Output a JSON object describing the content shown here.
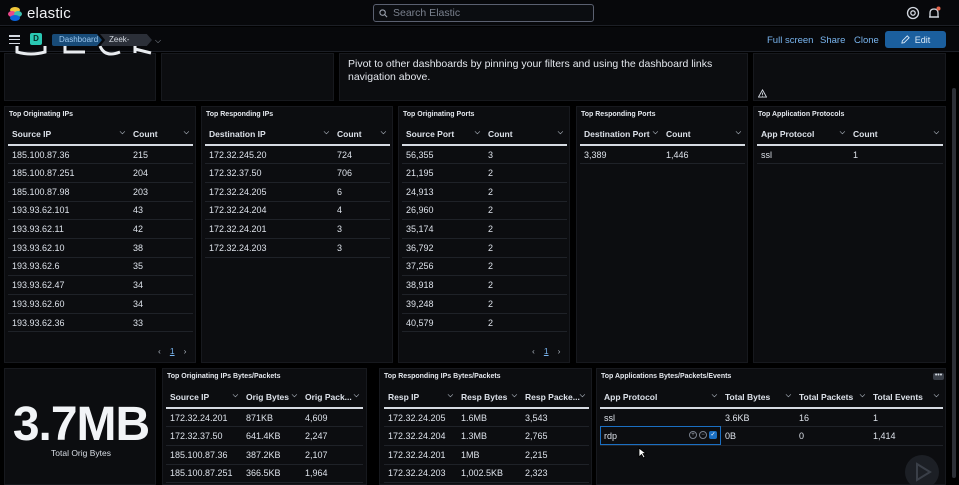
{
  "app": {
    "name": "elastic"
  },
  "search": {
    "placeholder": "Search Elastic"
  },
  "header_icons": [
    "help-icon",
    "notifications-icon"
  ],
  "nav": {
    "space_initial": "D",
    "breadcrumbs": [
      "Dashboard",
      "Zeek-Conn"
    ],
    "actions": [
      "Full screen",
      "Share",
      "Clone"
    ],
    "edit_label": "Edit"
  },
  "markdown": {
    "text": "Pivot to other dashboards by pinning your filters and using the dashboard links navigation above."
  },
  "top_originating_ips": {
    "title": "Top Originating IPs",
    "columns": [
      "Source IP",
      "Count"
    ],
    "rows": [
      [
        "185.100.87.36",
        "215"
      ],
      [
        "185.100.87.251",
        "204"
      ],
      [
        "185.100.87.98",
        "203"
      ],
      [
        "193.93.62.101",
        "43"
      ],
      [
        "193.93.62.11",
        "42"
      ],
      [
        "193.93.62.10",
        "38"
      ],
      [
        "193.93.62.6",
        "35"
      ],
      [
        "193.93.62.47",
        "34"
      ],
      [
        "193.93.62.60",
        "34"
      ],
      [
        "193.93.62.36",
        "33"
      ]
    ],
    "page": "1"
  },
  "top_responding_ips": {
    "title": "Top Responding IPs",
    "columns": [
      "Destination IP",
      "Count"
    ],
    "rows": [
      [
        "172.32.245.20",
        "724"
      ],
      [
        "172.32.37.50",
        "706"
      ],
      [
        "172.32.24.205",
        "6"
      ],
      [
        "172.32.24.204",
        "4"
      ],
      [
        "172.32.24.201",
        "3"
      ],
      [
        "172.32.24.203",
        "3"
      ]
    ]
  },
  "top_originating_ports": {
    "title": "Top Originating Ports",
    "columns": [
      "Source Port",
      "Count"
    ],
    "rows": [
      [
        "56,355",
        "3"
      ],
      [
        "21,195",
        "2"
      ],
      [
        "24,913",
        "2"
      ],
      [
        "26,960",
        "2"
      ],
      [
        "35,174",
        "2"
      ],
      [
        "36,792",
        "2"
      ],
      [
        "37,256",
        "2"
      ],
      [
        "38,918",
        "2"
      ],
      [
        "39,248",
        "2"
      ],
      [
        "40,579",
        "2"
      ]
    ],
    "page": "1"
  },
  "top_responding_ports": {
    "title": "Top Responding Ports",
    "columns": [
      "Destination Port",
      "Count"
    ],
    "rows": [
      [
        "3,389",
        "1,446"
      ]
    ]
  },
  "top_app_protocols": {
    "title": "Top Application Protocols",
    "columns": [
      "App Protocol",
      "Count"
    ],
    "rows": [
      [
        "ssl",
        "1"
      ]
    ]
  },
  "metric": {
    "value": "3.7MB",
    "label": "Total Orig Bytes"
  },
  "orig_bytes_packets": {
    "title": "Top Originating IPs Bytes/Packets",
    "columns": [
      "Source IP",
      "Orig Bytes",
      "Orig Pack..."
    ],
    "rows": [
      [
        "172.32.24.201",
        "871KB",
        "4,609"
      ],
      [
        "172.32.37.50",
        "641.4KB",
        "2,247"
      ],
      [
        "185.100.87.36",
        "387.2KB",
        "2,107"
      ],
      [
        "185.100.87.251",
        "366.5KB",
        "1,964"
      ]
    ]
  },
  "resp_bytes_packets": {
    "title": "Top Responding IPs Bytes/Packets",
    "columns": [
      "Resp IP",
      "Resp Bytes",
      "Resp Packe..."
    ],
    "rows": [
      [
        "172.32.24.205",
        "1.6MB",
        "3,543"
      ],
      [
        "172.32.24.204",
        "1.3MB",
        "2,765"
      ],
      [
        "172.32.24.201",
        "1MB",
        "2,215"
      ],
      [
        "172.32.24.203",
        "1,002.5KB",
        "2,323"
      ]
    ]
  },
  "app_bytes_packets": {
    "title": "Top Applications Bytes/Packets/Events",
    "columns": [
      "App Protocol",
      "Total Bytes",
      "Total Packets",
      "Total Events"
    ],
    "rows": [
      [
        "ssl",
        "3.6KB",
        "16",
        "1"
      ],
      [
        "rdp",
        "0B",
        "0",
        "1,414"
      ]
    ]
  },
  "colors": {
    "accent": "#1b5f9e",
    "link": "#79b5ef",
    "space": "#2ac8b3"
  }
}
